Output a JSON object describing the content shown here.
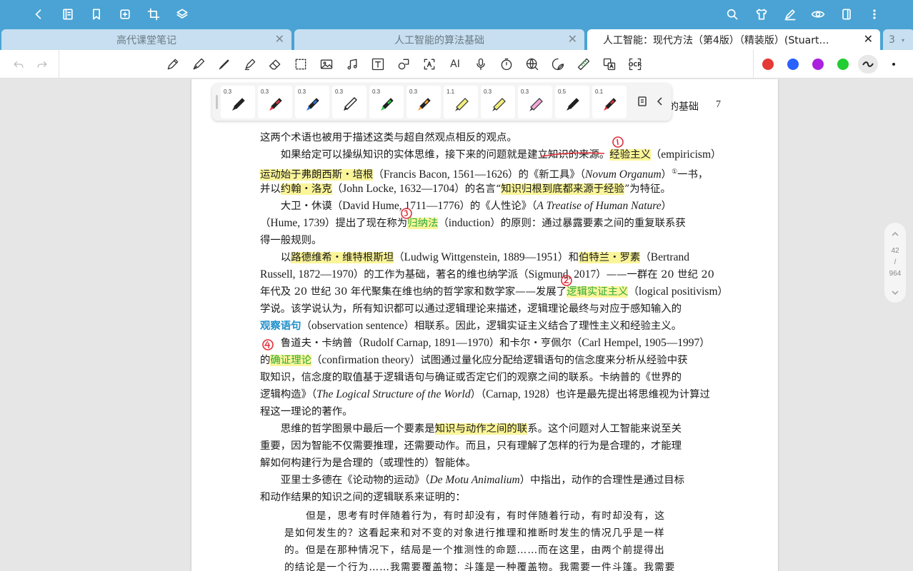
{
  "topbar": {
    "left_icons": [
      "back-icon",
      "book-icon",
      "bookmark-icon",
      "add-page-icon",
      "crop-icon",
      "layers-icon"
    ],
    "right_icons": [
      "search-icon",
      "tshirt-icon",
      "pen-edit-icon",
      "eye-icon",
      "sidebar-icon",
      "more-vertical-icon"
    ]
  },
  "tabs": [
    {
      "label": "高代课堂笔记",
      "active": false
    },
    {
      "label": "人工智能的算法基础",
      "active": false
    },
    {
      "label": "人工智能：现代方法（第4版）（精装版）(Stuart…",
      "active": true
    },
    {
      "label": "3",
      "active": false
    }
  ],
  "tab_close": "✕",
  "toolbar": {
    "tools": [
      "undo-icon",
      "redo-icon",
      "pencil-icon",
      "fountain-pen-icon",
      "brush-icon",
      "highlighter-icon",
      "eraser-icon",
      "lasso-select-icon",
      "image-icon",
      "audio-icon",
      "text-box-icon",
      "shape-icon",
      "text-recognize-icon",
      "ai-icon",
      "microphone-icon",
      "timer-icon",
      "web-search-icon",
      "sticker-icon",
      "ruler-icon",
      "translate-icon",
      "ocr-icon"
    ],
    "ai_label": "AI",
    "ocr_label": "OCR",
    "colors": [
      "#e53935",
      "#2962ff",
      "#aa22dd",
      "#22cc33"
    ]
  },
  "penbar": {
    "pens": [
      {
        "size": "0.3",
        "color": "#222222",
        "kind": "pen"
      },
      {
        "size": "0.3",
        "color": "#e0303a",
        "kind": "pen"
      },
      {
        "size": "0.3",
        "color": "#2a6fd6",
        "kind": "pen"
      },
      {
        "size": "0.3",
        "color": "#222222",
        "kind": "outline-pen"
      },
      {
        "size": "0.3",
        "color": "#27c93f",
        "kind": "pen"
      },
      {
        "size": "0.3",
        "color": "#f0a030",
        "kind": "pen"
      },
      {
        "size": "1.1",
        "color": "#f3ee7a",
        "kind": "highlighter"
      },
      {
        "size": "0.3",
        "color": "#f3ee7a",
        "kind": "highlighter"
      },
      {
        "size": "0.3",
        "color": "#f2a8d8",
        "kind": "highlighter"
      },
      {
        "size": "0.5",
        "color": "#222222",
        "kind": "pen"
      },
      {
        "size": "0.1",
        "color": "#e0303a",
        "kind": "pen"
      }
    ]
  },
  "page": {
    "running_head": "的基础",
    "page_number": "7",
    "lines": [
      [
        "这两个术语也被用于描述这类与超自然观点相反的观点。"
      ],
      [
        "　　如果给定可以操纵知识的实体思维，接下来的问题就是建立知识的来源。",
        "经验主义",
        "（",
        "empiricism",
        "）"
      ],
      [
        "运动始于弗朗西斯・培根",
        "（",
        "Francis Bacon, 1561—1626",
        "）的《新工具》（",
        "Novum Organum",
        "）",
        "①",
        "一书，"
      ],
      [
        "并以",
        "约翰・洛克",
        "（",
        "John Locke, 1632—1704",
        "）的名言“",
        "知识归根到底都来源于经验",
        "”为特征。"
      ],
      [
        "　　大卫・休谟（",
        "David Hume, 1711—1776",
        "）的《人性论》（",
        "A Treatise of Human Nature",
        "）"
      ],
      [
        "（",
        "Hume, 1739",
        "）提出了现在称为",
        "归纳法",
        "（",
        "induction",
        "）的原则：通过暴露要素之间的重复联系获"
      ],
      [
        "得一般规则。"
      ],
      [
        "　　以",
        "路德维希・维特根斯坦",
        "（",
        "Ludwig Wittgenstein, 1889—1951",
        "）和",
        "伯特兰・罗素",
        "（",
        "Bertrand"
      ],
      [
        "Russell, 1872—1970",
        "）的工作为基础，著名的维也纳学派（",
        "Sigmund, 2017",
        "）——一群在 20 世纪 20"
      ],
      [
        "年代及 20 世纪 30 年代聚集在维也纳的哲学家和数学家——发展了",
        "逻辑实证主义",
        "（",
        "logical positivism",
        "）"
      ],
      [
        "学说。该学说认为，所有知识都可以通过逻辑理论来描述，逻辑理论最终与对应于感知输入的"
      ],
      [
        "观察语句",
        "（",
        "observation sentence",
        "）相联系。因此，逻辑实证主义结合了理性主义和经验主义。"
      ],
      [
        "　　鲁道夫・卡纳普（",
        "Rudolf Carnap, 1891—1970",
        "）和卡尔・亨佩尔（",
        "Carl Hempel, 1905—1997",
        "）"
      ],
      [
        "的",
        "确证理论",
        "（",
        "confirmation theory",
        "）试图通过量化应分配给逻辑语句的信念度来分析从经验中获"
      ],
      [
        "取知识，信念度的取值基于逻辑语句与确证或否定它们的观察之间的联系。卡纳普的《世界的"
      ],
      [
        "逻辑构造》（",
        "The Logical Structure of the World",
        "）（",
        "Carnap, 1928",
        "）也许是最先提出将思维视为计算过"
      ],
      [
        "程这一理论的著作。"
      ],
      [
        "　　思维的哲学图景中最后一个要素是",
        "知识与动作之间的联",
        "系。这个问题对人工智能来说至关"
      ],
      [
        "重要，因为智能不仅需要推理，还需要动作。而且，只有理解了怎样的行为是合理的，才能理"
      ],
      [
        "解如何构建行为是合理的（或理性的）智能体。"
      ],
      [
        "　　亚里士多德在《论动物的运动》（",
        "De Motu Animalium",
        "）中指出，动作的合理性是通过目标"
      ],
      [
        "和动作结果的知识之间的逻辑联系来证明的："
      ]
    ],
    "quote": [
      "但是，思考有时伴随着行为，有时却没有，有时伴随着行动，有时却没有，这",
      "是如何发生的？这看起来和对不变的对象进行推理和推断时发生的情况几乎是一样",
      "的。但是在那种情况下，结局是一个推测性的命题……而在这里，由两个前提得出",
      "的结论是一个行为……我需要覆盖物；斗篷是一种覆盖物。我需要一件斗篷。我需要"
    ]
  },
  "annotations": [
    "①",
    "②",
    "③",
    "④"
  ],
  "pagenav": {
    "current": "42",
    "sep": "/",
    "total": "964"
  }
}
